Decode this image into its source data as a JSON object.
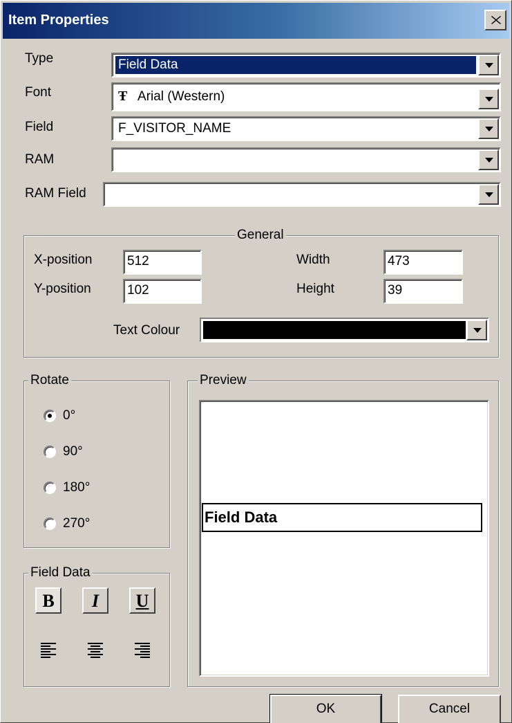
{
  "window": {
    "title": "Item Properties"
  },
  "fields": {
    "type": {
      "label": "Type",
      "value": "Field Data"
    },
    "font": {
      "label": "Font",
      "value": "Arial (Western)",
      "icon": "truetype-font-icon"
    },
    "field": {
      "label": "Field",
      "value": "F_VISITOR_NAME"
    },
    "ram": {
      "label": "RAM",
      "value": ""
    },
    "ram_field": {
      "label": "RAM Field",
      "value": ""
    }
  },
  "general": {
    "title": "General",
    "x_label": "X-position",
    "x_value": "512",
    "y_label": "Y-position",
    "y_value": "102",
    "width_label": "Width",
    "width_value": "473",
    "height_label": "Height",
    "height_value": "39",
    "text_colour_label": "Text Colour",
    "text_colour": "#000000"
  },
  "rotate": {
    "title": "Rotate",
    "options": [
      "0°",
      "90°",
      "180°",
      "270°"
    ],
    "selected": "0°"
  },
  "field_data": {
    "title": "Field Data",
    "bold": "B",
    "italic": "I",
    "underline": "U",
    "bold_pressed": true,
    "align": [
      "align-left-icon",
      "align-center-icon",
      "align-right-icon"
    ]
  },
  "preview": {
    "title": "Preview",
    "text": "Field Data"
  },
  "buttons": {
    "ok": "OK",
    "cancel": "Cancel"
  }
}
